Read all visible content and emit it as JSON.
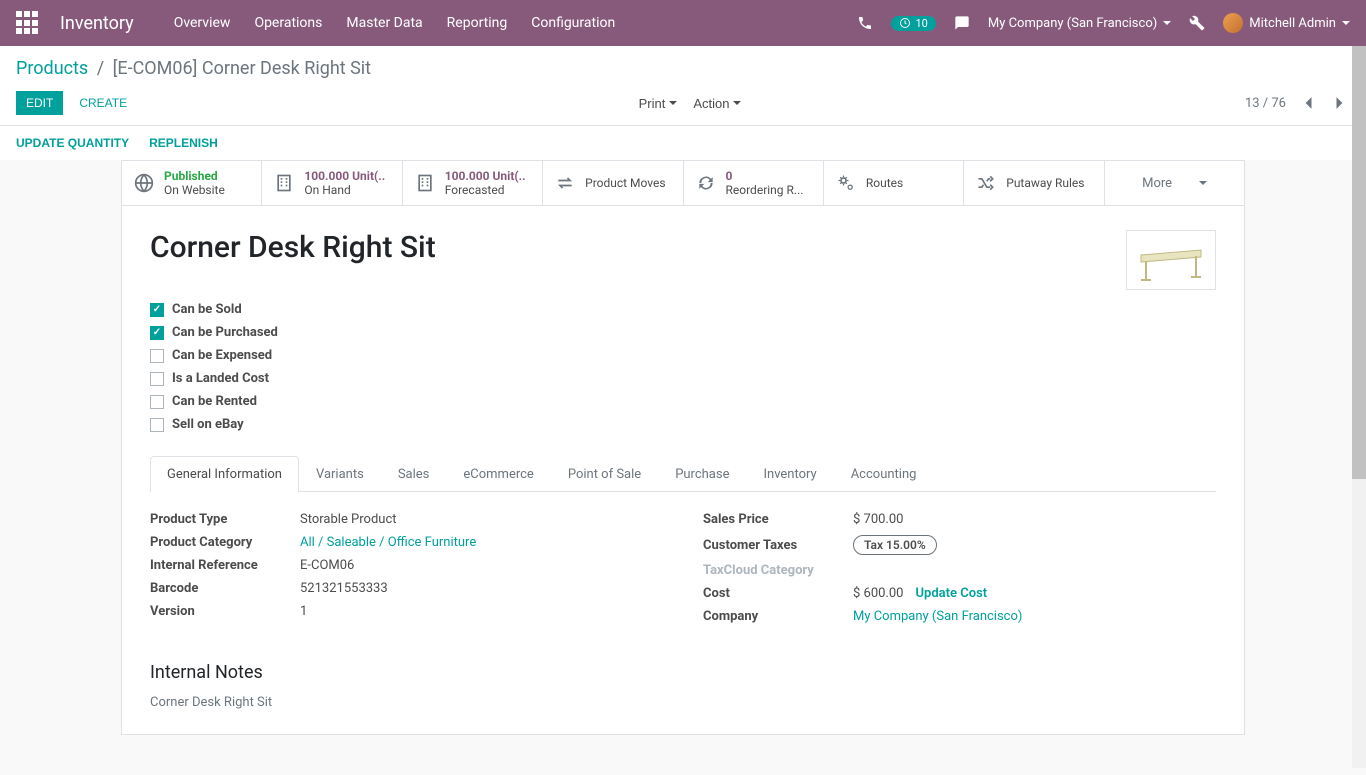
{
  "navbar": {
    "brand": "Inventory",
    "menu": [
      "Overview",
      "Operations",
      "Master Data",
      "Reporting",
      "Configuration"
    ],
    "badge_count": "10",
    "company": "My Company (San Francisco)",
    "user": "Mitchell Admin"
  },
  "breadcrumb": {
    "root": "Products",
    "current": "[E-COM06] Corner Desk Right Sit"
  },
  "buttons": {
    "edit": "EDIT",
    "create": "CREATE",
    "print": "Print",
    "action": "Action",
    "update_quantity": "UPDATE QUANTITY",
    "replenish": "REPLENISH"
  },
  "pager": "13 / 76",
  "stat_boxes": [
    {
      "value": "Published",
      "label": "On Website",
      "value_class": "green",
      "icon": "globe"
    },
    {
      "value": "100.000 Unit(..",
      "label": "On Hand",
      "icon": "building"
    },
    {
      "value": "100.000 Unit(..",
      "label": "Forecasted",
      "icon": "building"
    },
    {
      "value": "",
      "label": "Product Moves",
      "icon": "exchange",
      "single": true
    },
    {
      "value": "0",
      "label": "Reordering R...",
      "icon": "refresh"
    },
    {
      "value": "",
      "label": "Routes",
      "icon": "cogs",
      "single": true
    },
    {
      "value": "",
      "label": "Putaway Rules",
      "icon": "random",
      "single": true
    }
  ],
  "more_label": "More",
  "title": "Corner Desk Right Sit",
  "checkboxes": [
    {
      "label": "Can be Sold",
      "checked": true
    },
    {
      "label": "Can be Purchased",
      "checked": true
    },
    {
      "label": "Can be Expensed",
      "checked": false
    },
    {
      "label": "Is a Landed Cost",
      "checked": false
    },
    {
      "label": "Can be Rented",
      "checked": false
    },
    {
      "label": "Sell on eBay",
      "checked": false
    }
  ],
  "tabs": [
    "General Information",
    "Variants",
    "Sales",
    "eCommerce",
    "Point of Sale",
    "Purchase",
    "Inventory",
    "Accounting"
  ],
  "active_tab": 0,
  "fields_left": [
    {
      "label": "Product Type",
      "value": "Storable Product"
    },
    {
      "label": "Product Category",
      "value": "All / Saleable / Office Furniture",
      "link": true
    },
    {
      "label": "Internal Reference",
      "value": "E-COM06"
    },
    {
      "label": "Barcode",
      "value": "521321553333"
    },
    {
      "label": "Version",
      "value": "1"
    }
  ],
  "fields_right": [
    {
      "label": "Sales Price",
      "value": "$ 700.00"
    },
    {
      "label": "Customer Taxes",
      "value": "Tax 15.00%",
      "badge": true
    },
    {
      "label": "TaxCloud Category",
      "value": "",
      "muted": true
    },
    {
      "label": "Cost",
      "value": "$ 600.00",
      "action": "Update Cost"
    },
    {
      "label": "Company",
      "value": "My Company (San Francisco)",
      "link": true
    }
  ],
  "notes_title": "Internal Notes",
  "notes_value": "Corner Desk Right Sit"
}
